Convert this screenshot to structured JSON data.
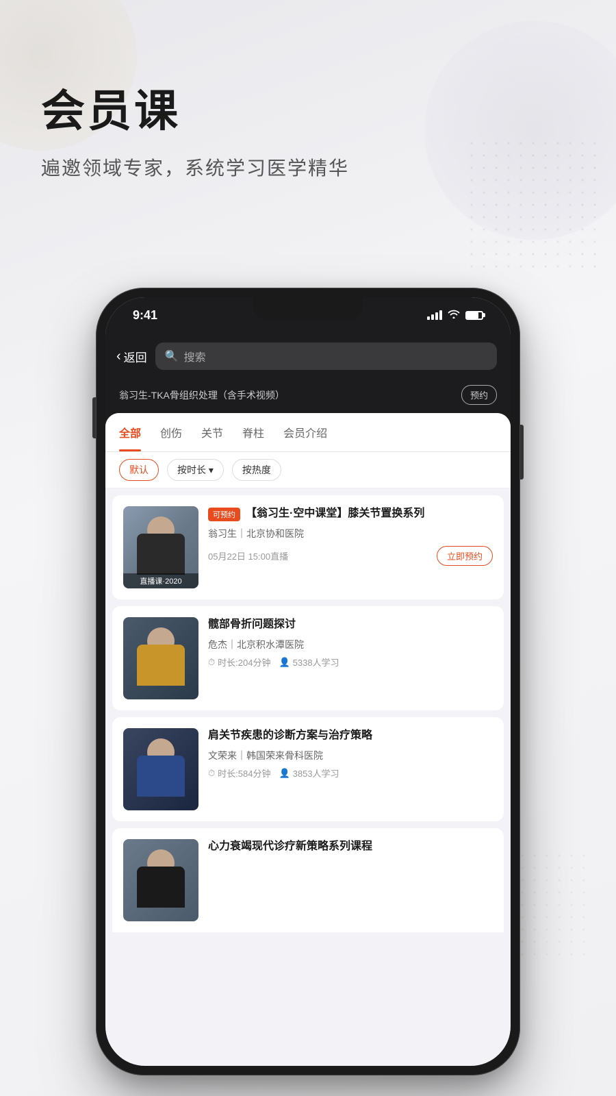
{
  "page": {
    "bg_title": "会员课",
    "bg_subtitle": "遍邀领域专家，系统学习医学精华"
  },
  "status_bar": {
    "time": "9:41",
    "signal_label": "signal",
    "wifi_label": "wifi",
    "battery_label": "battery"
  },
  "nav": {
    "back_label": "返回",
    "search_placeholder": "搜索"
  },
  "banner": {
    "title": "翁习生-TKA骨组织处理（含手术视频）",
    "reserve_label": "预约"
  },
  "tabs": [
    {
      "id": "all",
      "label": "全部",
      "active": true
    },
    {
      "id": "trauma",
      "label": "创伤",
      "active": false
    },
    {
      "id": "joint",
      "label": "关节",
      "active": false
    },
    {
      "id": "spine",
      "label": "脊柱",
      "active": false
    },
    {
      "id": "member",
      "label": "会员介绍",
      "active": false
    }
  ],
  "filters": [
    {
      "id": "default",
      "label": "默认",
      "active": true
    },
    {
      "id": "duration",
      "label": "按时长 ▾",
      "active": false
    },
    {
      "id": "popularity",
      "label": "按热度",
      "active": false
    }
  ],
  "courses": [
    {
      "id": 1,
      "tag": "可预约",
      "title": "【翁习生·空中课堂】膝关节置换系列",
      "author": "翁习生｜北京协和医院",
      "live_time": "05月22日 15:00直播",
      "action_label": "立即预约",
      "thumb_label": "直播课·2020",
      "has_tag": true,
      "has_action": true
    },
    {
      "id": 2,
      "tag": "",
      "title": "髋部骨折问题探讨",
      "author": "危杰｜北京积水潭医院",
      "duration": "时长:204分钟",
      "students": "5338人学习",
      "has_tag": false,
      "has_action": false
    },
    {
      "id": 3,
      "tag": "",
      "title": "肩关节疾患的诊断方案与治疗策略",
      "author": "文荣来｜韩国荣来骨科医院",
      "duration": "时长:584分钟",
      "students": "3853人学习",
      "has_tag": false,
      "has_action": false
    },
    {
      "id": 4,
      "tag": "",
      "title": "心力衰竭现代诊疗新策略系列课程",
      "author": "",
      "duration": "",
      "students": "",
      "has_tag": false,
      "has_action": false,
      "partial": true
    }
  ],
  "icons": {
    "clock": "⏱",
    "users": "👤",
    "search": "🔍",
    "chevron_left": "‹"
  }
}
